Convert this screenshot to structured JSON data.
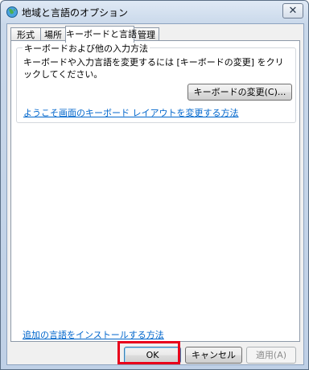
{
  "window": {
    "title": "地域と言語のオプション",
    "close_symbol": "✕"
  },
  "tabs": [
    {
      "label": "形式"
    },
    {
      "label": "場所"
    },
    {
      "label": "キーボードと言語",
      "active": true
    },
    {
      "label": "管理"
    }
  ],
  "keyboard_group": {
    "title": "キーボードおよび他の入力方法",
    "description": "キーボードや入力言語を変更するには [キーボードの変更] をクリックしてください。",
    "change_button_label": "キーボードの変更(C)...",
    "layout_link": "ようこそ画面のキーボード レイアウトを変更する方法"
  },
  "install_link": "追加の言語をインストールする方法",
  "footer": {
    "ok_label": "OK",
    "cancel_label": "キャンセル",
    "apply_label": "適用(A)"
  },
  "colors": {
    "highlight": "#e8001c",
    "link": "#0066cc"
  },
  "icons": {
    "title_icon": "globe-icon",
    "close": "close-icon"
  }
}
